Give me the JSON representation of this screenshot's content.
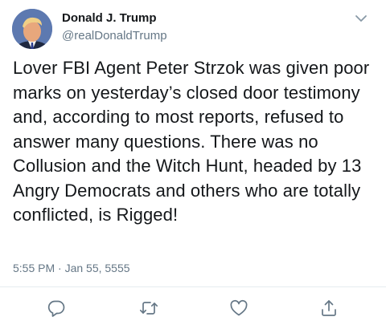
{
  "user": {
    "display_name": "Donald J. Trump",
    "handle": "@realDonaldTrump"
  },
  "tweet": {
    "text": "Lover FBI Agent Peter Strzok was given poor marks on yesterday’s closed door testimony and, according to most reports, refused to answer many questions. There was no Collusion and the Witch Hunt, headed by 13 Angry Democrats and others who are totally conflicted, is Rigged!",
    "timestamp": "5:55 PM · Jan 55, 5555"
  },
  "actions": {
    "reply_icon": "reply-icon",
    "retweet_icon": "retweet-icon",
    "like_icon": "heart-icon",
    "share_icon": "share-icon"
  },
  "colors": {
    "text": "#14171a",
    "secondary": "#657786",
    "divider": "#e6ecf0"
  }
}
